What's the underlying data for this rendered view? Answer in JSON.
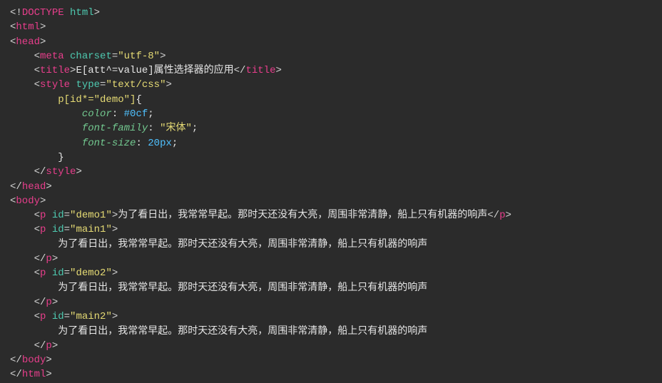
{
  "code": {
    "doctype": "DOCTYPE",
    "doctype_name": "html",
    "html_tag": "html",
    "head_tag": "head",
    "meta_tag": "meta",
    "meta_attr": "charset",
    "meta_val": "\"utf-8\"",
    "title_tag": "title",
    "title_text": "E[att^=value]属性选择器的应用",
    "style_tag": "style",
    "style_attr": "type",
    "style_val": "\"text/css\"",
    "css_selector": "p[id*=\"demo\"]",
    "css_brace_open": "{",
    "css_brace_close": "}",
    "css_p1_prop": "color",
    "css_p1_val": "#0cf",
    "css_p2_prop": "font-family",
    "css_p2_val": "\"宋体\"",
    "css_p3_prop": "font-size",
    "css_p3_val": "20px",
    "body_tag": "body",
    "p_tag": "p",
    "id_attr": "id",
    "p1_id": "\"demo1\"",
    "p2_id": "\"main1\"",
    "p3_id": "\"demo2\"",
    "p4_id": "\"main2\"",
    "paragraph_text": "为了看日出，我常常早起。那时天还没有大亮，周围非常清静，船上只有机器的响声",
    "colon": ":",
    "semicolon": ";"
  }
}
